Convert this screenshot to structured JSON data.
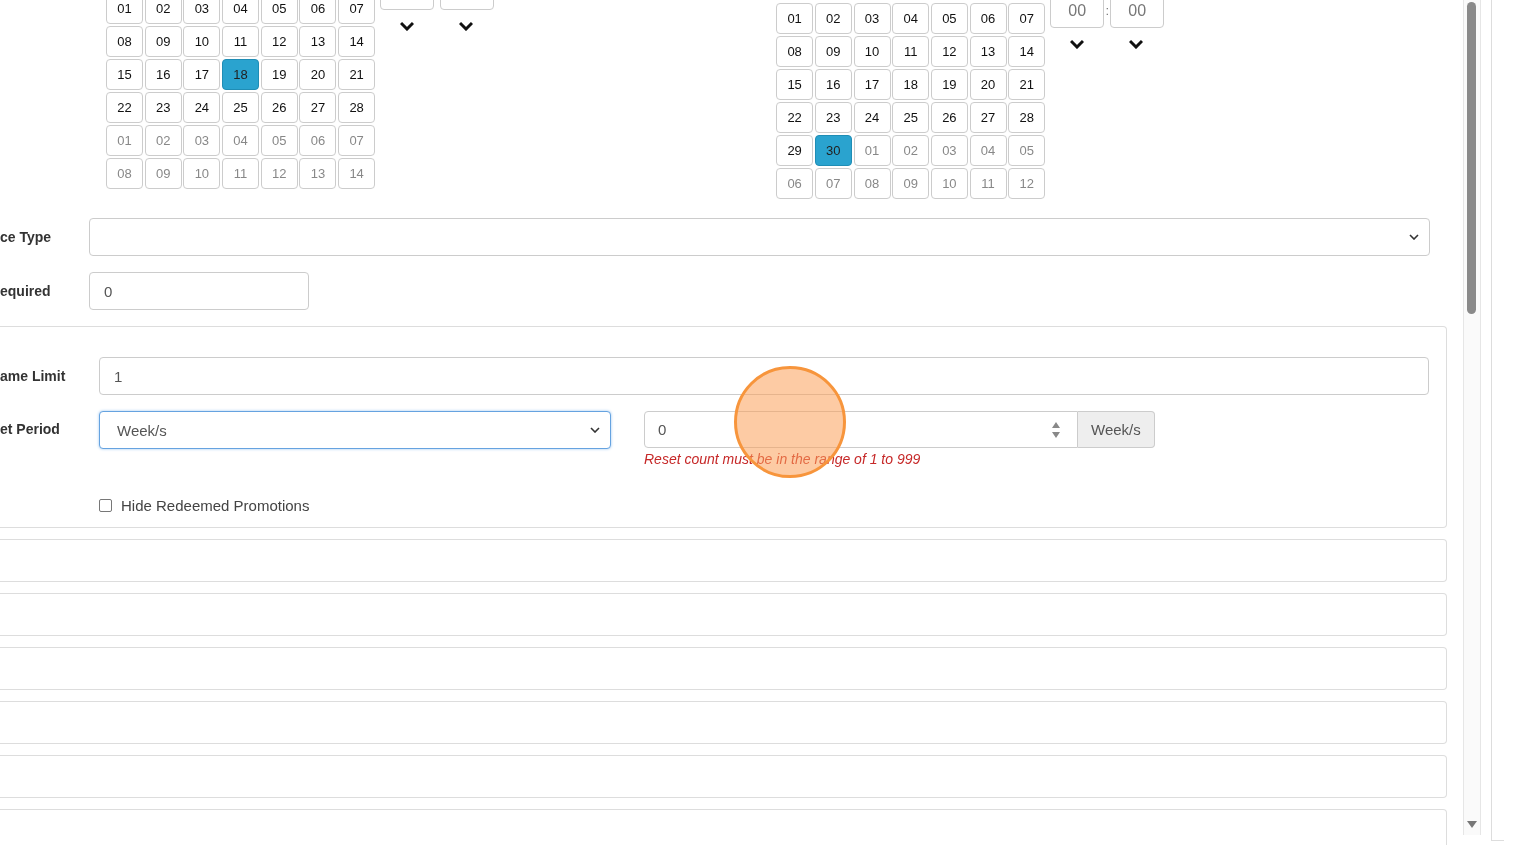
{
  "date_pickers": [
    {
      "weeks": [
        [
          {
            "label": "01",
            "selected": false,
            "other_month": false
          },
          {
            "label": "02",
            "selected": false,
            "other_month": false
          },
          {
            "label": "03",
            "selected": false,
            "other_month": false
          },
          {
            "label": "04",
            "selected": false,
            "other_month": false
          },
          {
            "label": "05",
            "selected": false,
            "other_month": false
          },
          {
            "label": "06",
            "selected": false,
            "other_month": false
          },
          {
            "label": "07",
            "selected": false,
            "other_month": false
          }
        ],
        [
          {
            "label": "08",
            "selected": false,
            "other_month": false
          },
          {
            "label": "09",
            "selected": false,
            "other_month": false
          },
          {
            "label": "10",
            "selected": false,
            "other_month": false
          },
          {
            "label": "11",
            "selected": false,
            "other_month": false
          },
          {
            "label": "12",
            "selected": false,
            "other_month": false
          },
          {
            "label": "13",
            "selected": false,
            "other_month": false
          },
          {
            "label": "14",
            "selected": false,
            "other_month": false
          }
        ],
        [
          {
            "label": "15",
            "selected": false,
            "other_month": false
          },
          {
            "label": "16",
            "selected": false,
            "other_month": false
          },
          {
            "label": "17",
            "selected": false,
            "other_month": false
          },
          {
            "label": "18",
            "selected": true,
            "other_month": false
          },
          {
            "label": "19",
            "selected": false,
            "other_month": false
          },
          {
            "label": "20",
            "selected": false,
            "other_month": false
          },
          {
            "label": "21",
            "selected": false,
            "other_month": false
          }
        ],
        [
          {
            "label": "22",
            "selected": false,
            "other_month": false
          },
          {
            "label": "23",
            "selected": false,
            "other_month": false
          },
          {
            "label": "24",
            "selected": false,
            "other_month": false
          },
          {
            "label": "25",
            "selected": false,
            "other_month": false
          },
          {
            "label": "26",
            "selected": false,
            "other_month": false
          },
          {
            "label": "27",
            "selected": false,
            "other_month": false
          },
          {
            "label": "28",
            "selected": false,
            "other_month": false
          }
        ],
        [
          {
            "label": "01",
            "selected": false,
            "other_month": true
          },
          {
            "label": "02",
            "selected": false,
            "other_month": true
          },
          {
            "label": "03",
            "selected": false,
            "other_month": true
          },
          {
            "label": "04",
            "selected": false,
            "other_month": true
          },
          {
            "label": "05",
            "selected": false,
            "other_month": true
          },
          {
            "label": "06",
            "selected": false,
            "other_month": true
          },
          {
            "label": "07",
            "selected": false,
            "other_month": true
          }
        ],
        [
          {
            "label": "08",
            "selected": false,
            "other_month": true
          },
          {
            "label": "09",
            "selected": false,
            "other_month": true
          },
          {
            "label": "10",
            "selected": false,
            "other_month": true
          },
          {
            "label": "11",
            "selected": false,
            "other_month": true
          },
          {
            "label": "12",
            "selected": false,
            "other_month": true
          },
          {
            "label": "13",
            "selected": false,
            "other_month": true
          },
          {
            "label": "14",
            "selected": false,
            "other_month": true
          }
        ]
      ],
      "show_time_values": false
    },
    {
      "weeks": [
        [
          {
            "label": "01",
            "selected": false,
            "other_month": false
          },
          {
            "label": "02",
            "selected": false,
            "other_month": false
          },
          {
            "label": "03",
            "selected": false,
            "other_month": false
          },
          {
            "label": "04",
            "selected": false,
            "other_month": false
          },
          {
            "label": "05",
            "selected": false,
            "other_month": false
          },
          {
            "label": "06",
            "selected": false,
            "other_month": false
          },
          {
            "label": "07",
            "selected": false,
            "other_month": false
          }
        ],
        [
          {
            "label": "08",
            "selected": false,
            "other_month": false
          },
          {
            "label": "09",
            "selected": false,
            "other_month": false
          },
          {
            "label": "10",
            "selected": false,
            "other_month": false
          },
          {
            "label": "11",
            "selected": false,
            "other_month": false
          },
          {
            "label": "12",
            "selected": false,
            "other_month": false
          },
          {
            "label": "13",
            "selected": false,
            "other_month": false
          },
          {
            "label": "14",
            "selected": false,
            "other_month": false
          }
        ],
        [
          {
            "label": "15",
            "selected": false,
            "other_month": false
          },
          {
            "label": "16",
            "selected": false,
            "other_month": false
          },
          {
            "label": "17",
            "selected": false,
            "other_month": false
          },
          {
            "label": "18",
            "selected": false,
            "other_month": false
          },
          {
            "label": "19",
            "selected": false,
            "other_month": false
          },
          {
            "label": "20",
            "selected": false,
            "other_month": false
          },
          {
            "label": "21",
            "selected": false,
            "other_month": false
          }
        ],
        [
          {
            "label": "22",
            "selected": false,
            "other_month": false
          },
          {
            "label": "23",
            "selected": false,
            "other_month": false
          },
          {
            "label": "24",
            "selected": false,
            "other_month": false
          },
          {
            "label": "25",
            "selected": false,
            "other_month": false
          },
          {
            "label": "26",
            "selected": false,
            "other_month": false
          },
          {
            "label": "27",
            "selected": false,
            "other_month": false
          },
          {
            "label": "28",
            "selected": false,
            "other_month": false
          }
        ],
        [
          {
            "label": "29",
            "selected": false,
            "other_month": false
          },
          {
            "label": "30",
            "selected": true,
            "other_month": false
          },
          {
            "label": "01",
            "selected": false,
            "other_month": true
          },
          {
            "label": "02",
            "selected": false,
            "other_month": true
          },
          {
            "label": "03",
            "selected": false,
            "other_month": true
          },
          {
            "label": "04",
            "selected": false,
            "other_month": true
          },
          {
            "label": "05",
            "selected": false,
            "other_month": true
          }
        ],
        [
          {
            "label": "06",
            "selected": false,
            "other_month": true
          },
          {
            "label": "07",
            "selected": false,
            "other_month": true
          },
          {
            "label": "08",
            "selected": false,
            "other_month": true
          },
          {
            "label": "09",
            "selected": false,
            "other_month": true
          },
          {
            "label": "10",
            "selected": false,
            "other_month": true
          },
          {
            "label": "11",
            "selected": false,
            "other_month": true
          },
          {
            "label": "12",
            "selected": false,
            "other_month": true
          }
        ]
      ],
      "show_time_values": true,
      "hours": "00",
      "separator": ":",
      "minutes": "00"
    }
  ],
  "fields": [
    {
      "label": "ce Type",
      "kind": "select",
      "wide": true
    },
    {
      "label": "equired",
      "kind": "text",
      "value": "0",
      "wide": false
    }
  ],
  "limits_panel": {
    "fields": [
      {
        "label": "ame Limit",
        "value": "1"
      }
    ],
    "reset": {
      "label": "et Period",
      "period": "Week/s",
      "count": "0",
      "unit": "Week/s",
      "error": "Reset count must be in the range of 1 to 999"
    },
    "hide_redeemed": {
      "label": "Hide Redeemed Promotions",
      "checked": false
    }
  }
}
